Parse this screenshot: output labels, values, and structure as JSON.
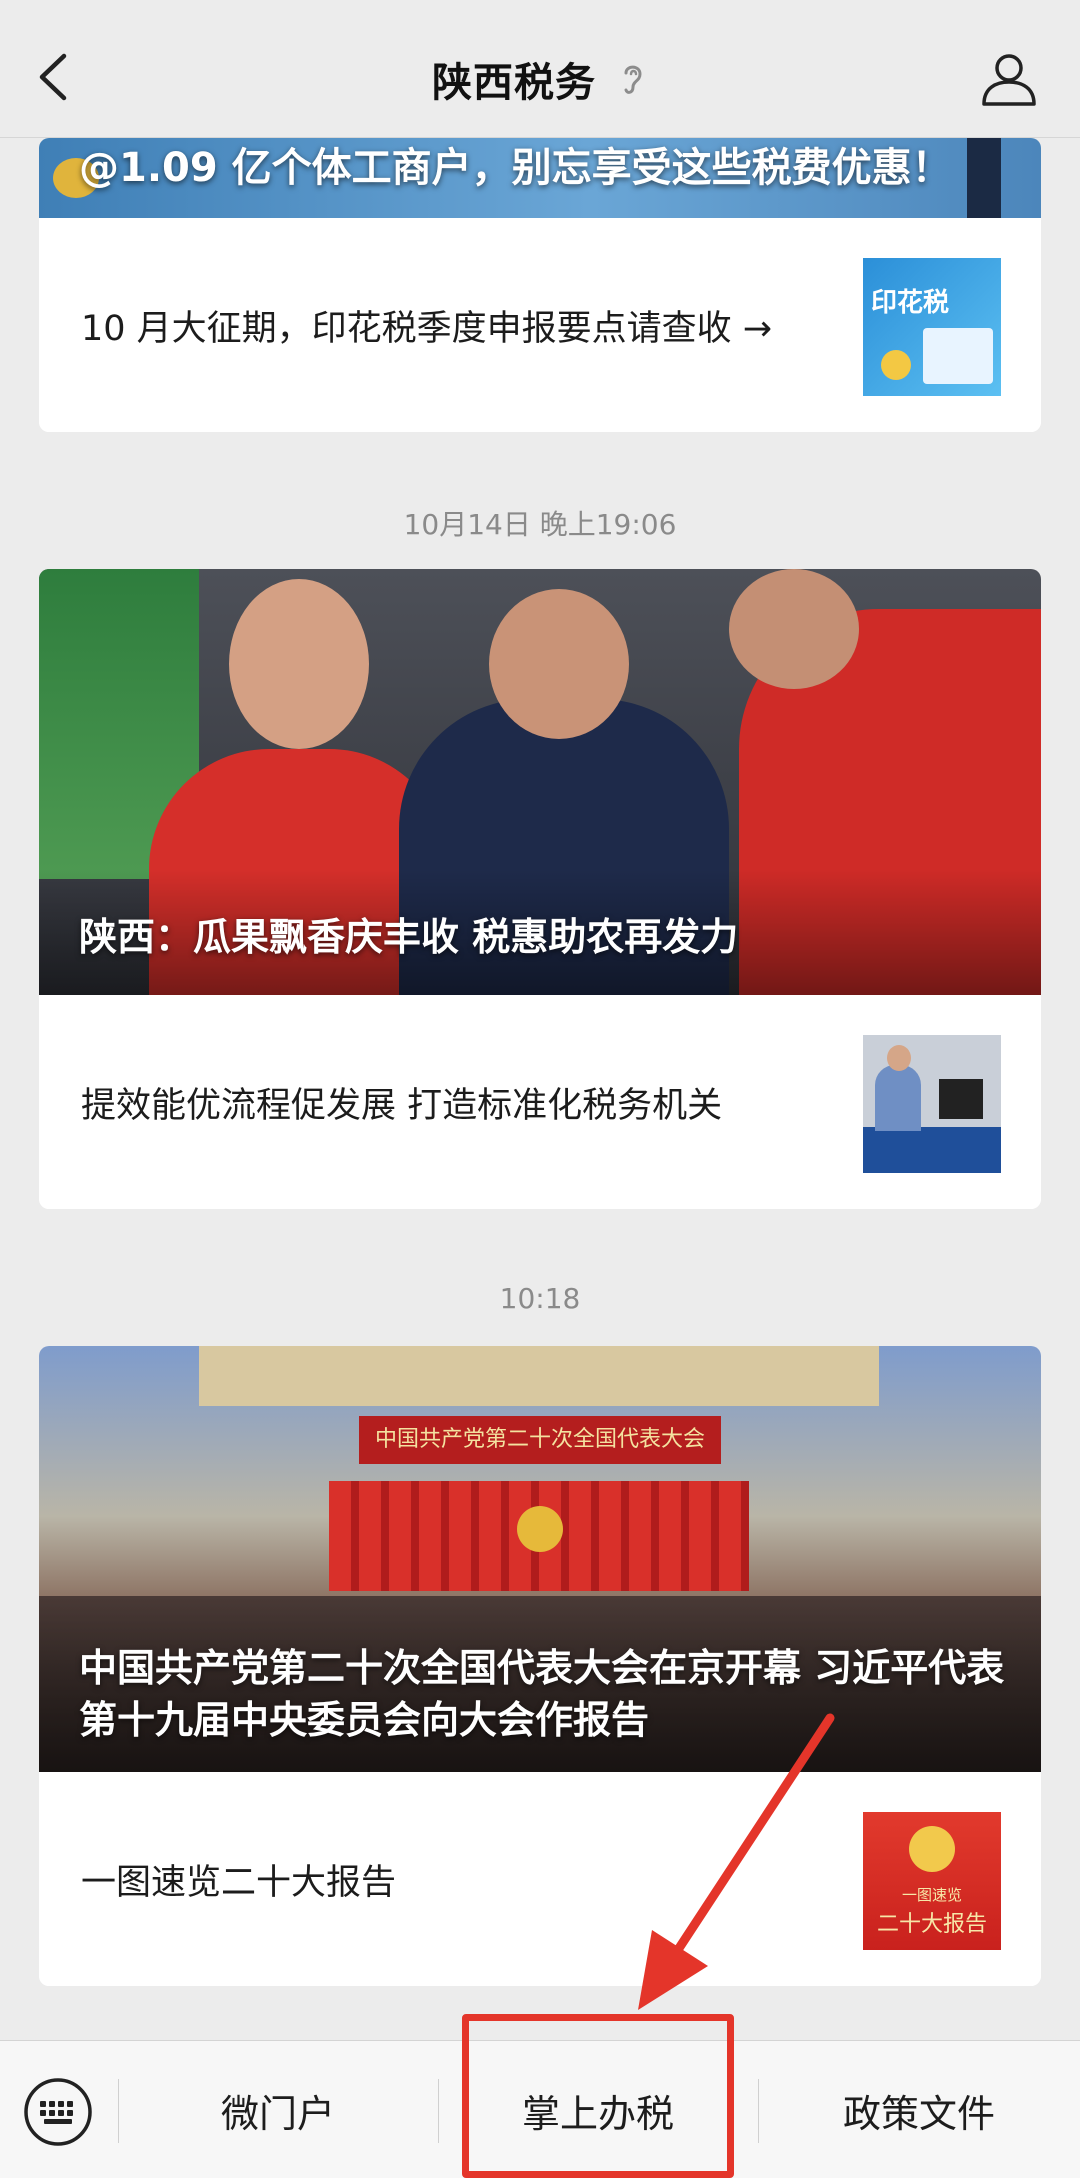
{
  "header": {
    "title": "陕西税务",
    "back_icon": "chevron-left-icon",
    "listen_icon": "ear-icon",
    "profile_icon": "person-icon"
  },
  "feed": {
    "group1": {
      "banner_title": "@1.09 亿个体工商户，别忘享受这些税费优惠！",
      "articles": [
        {
          "title": "10 月大征期，印花税季度申报要点请查收 →",
          "thumb_text": "印花税"
        }
      ]
    },
    "group2": {
      "time": "10月14日 晚上19:06",
      "hero_title": "陕西：瓜果飘香庆丰收 税惠助农再发力",
      "articles": [
        {
          "title": "提效能优流程促发展 打造标准化税务机关"
        }
      ]
    },
    "group3": {
      "time": "10:18",
      "hero_title": "中国共产党第二十次全国代表大会在京开幕 习近平代表第十九届中央委员会向大会作报告",
      "hero_banner": "中国共产党第二十次全国代表大会",
      "articles": [
        {
          "title": "一图速览二十大报告",
          "thumb_line1": "一图速览",
          "thumb_line2": "二十大报告"
        }
      ]
    }
  },
  "menu": {
    "keyboard_icon": "keyboard-icon",
    "items": [
      "微门户",
      "掌上办税",
      "政策文件"
    ]
  },
  "colors": {
    "background": "#ececec",
    "annotation_red": "#e4352a"
  }
}
